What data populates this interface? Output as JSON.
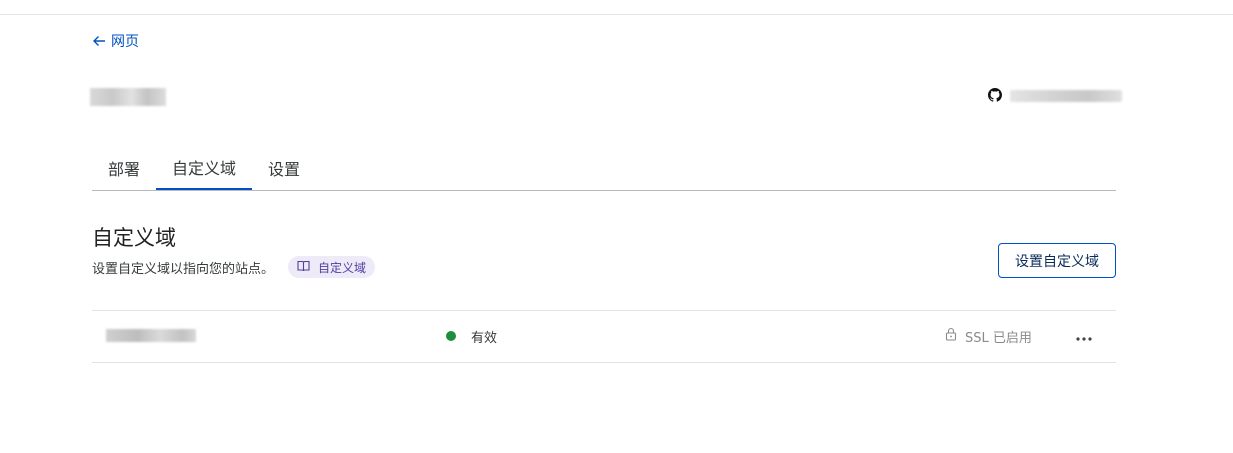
{
  "nav": {
    "back_label": "网页"
  },
  "header": {
    "project_name": "",
    "repo_name": ""
  },
  "tabs": [
    {
      "label": "部署",
      "active": false
    },
    {
      "label": "自定义域",
      "active": true
    },
    {
      "label": "设置",
      "active": false
    }
  ],
  "section": {
    "title": "自定义域",
    "description": "设置自定义域以指向您的站点。",
    "doc_link_label": "自定义域",
    "setup_button_label": "设置自定义域"
  },
  "domains": [
    {
      "name": "",
      "status": "有效",
      "ssl": "SSL 已启用"
    }
  ],
  "colors": {
    "accent": "#0051c3",
    "status_active": "#1e8e3e",
    "doc_pill_bg": "#eeeaf8",
    "doc_pill_text": "#4f3fa0"
  },
  "icons": {
    "back": "arrow-left-icon",
    "repo": "github-icon",
    "doc": "book-icon",
    "ssl": "lock-icon",
    "more": "more-horizontal-icon"
  }
}
